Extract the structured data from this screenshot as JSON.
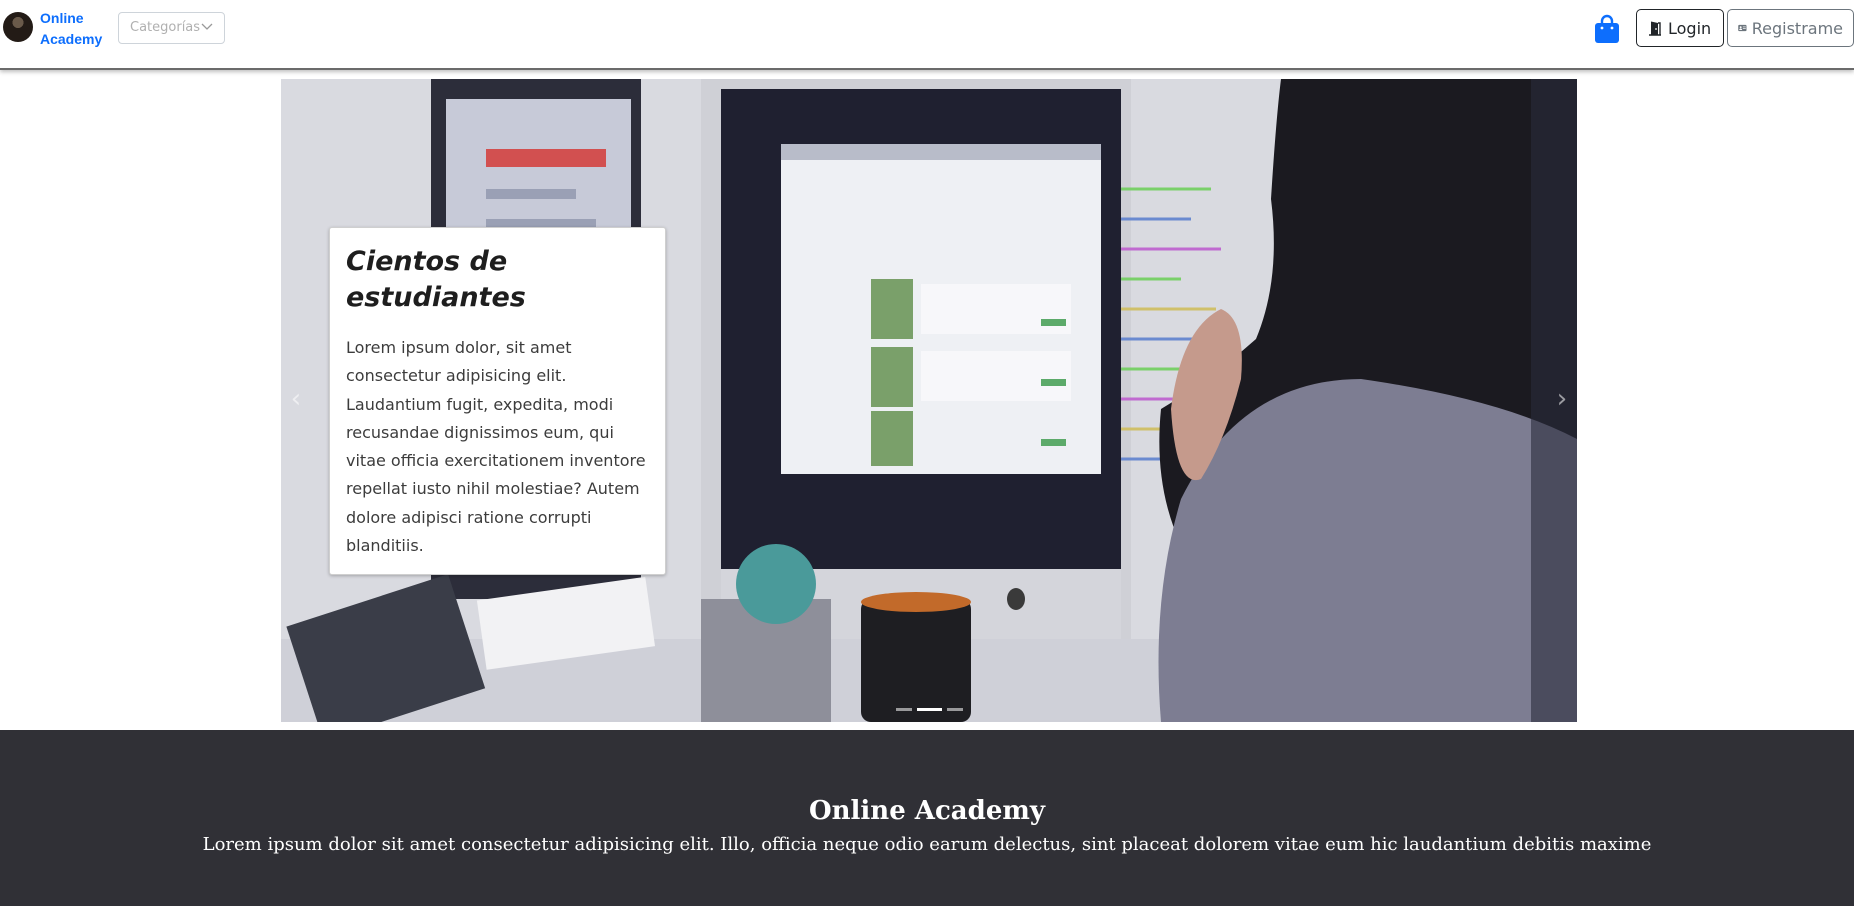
{
  "navbar": {
    "brand": "Online Academy",
    "category_select": {
      "value": "Categorías",
      "placeholder": "Categorías"
    },
    "cart_icon": "shopping-bag-icon",
    "login_label": "Login",
    "register_label": "Registrame",
    "accent_color": "#0d6efd"
  },
  "carousel": {
    "slides_count": 3,
    "active_slide": 2,
    "caption": {
      "title": "Cientos de estudiantes",
      "text": "Lorem ipsum dolor, sit amet consectetur adipisicing elit. Laudantium fugit, expedita, modi recusandae dignissimos eum, qui vitae officia exercitationem inventore repellat iusto nihil molestiae? Autem dolore adipisci ratione corrupti blanditiis."
    },
    "prev_icon": "chevron-left-icon",
    "next_icon": "chevron-right-icon"
  },
  "footer": {
    "title": "Online Academy",
    "text": "Lorem ipsum dolor sit amet consectetur adipisicing elit. Illo, officia neque odio earum delectus, sint placeat dolorem vitae eum hic laudantium debitis maxime",
    "background": "#303036"
  }
}
